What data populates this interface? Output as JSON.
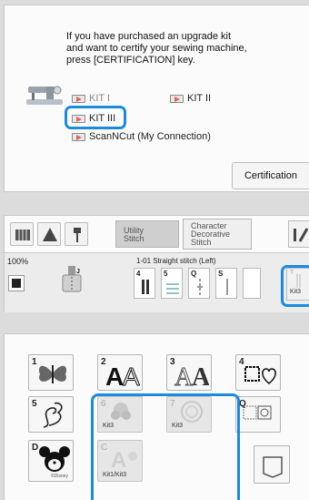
{
  "upgrade": {
    "message_lines": [
      "If you have purchased an upgrade kit",
      "and want to certify your sewing machine,",
      "press [CERTIFICATION] key."
    ],
    "kit_options": [
      {
        "label": "KIT I"
      },
      {
        "label": "KIT II"
      },
      {
        "label": "KIT III"
      },
      {
        "label": "ScanNCut (My Connection)"
      }
    ],
    "certification_label": "Certification",
    "accent_color": "#1c8ae0"
  },
  "stitch": {
    "tabs": [
      {
        "line1": "Utility",
        "line2": "Stitch"
      },
      {
        "line1": "Character",
        "line2": "Decorative",
        "line3": "Stitch"
      }
    ],
    "zoom": "100%",
    "stitch_name": "1-01 Straight stitch (Left)",
    "stitch_cards": [
      {
        "num": "4"
      },
      {
        "num": "5"
      },
      {
        "num": "Q"
      },
      {
        "num": "S"
      }
    ],
    "foot_letter": "J",
    "kit3_letter": "T",
    "kit3_label": "Kit3"
  },
  "patterns": {
    "categories": [
      {
        "label": "1",
        "kit": ""
      },
      {
        "label": "2",
        "kit": ""
      },
      {
        "label": "3",
        "kit": ""
      },
      {
        "label": "4",
        "kit": ""
      },
      {
        "label": "5",
        "kit": ""
      },
      {
        "label": "6",
        "kit": "Kit3"
      },
      {
        "label": "7",
        "kit": "Kit3"
      },
      {
        "label": "Q",
        "kit": ""
      },
      {
        "label": "D",
        "kit": "",
        "caption": "©Disney"
      },
      {
        "label": "C",
        "kit": "Kit1/Kit3"
      }
    ]
  }
}
